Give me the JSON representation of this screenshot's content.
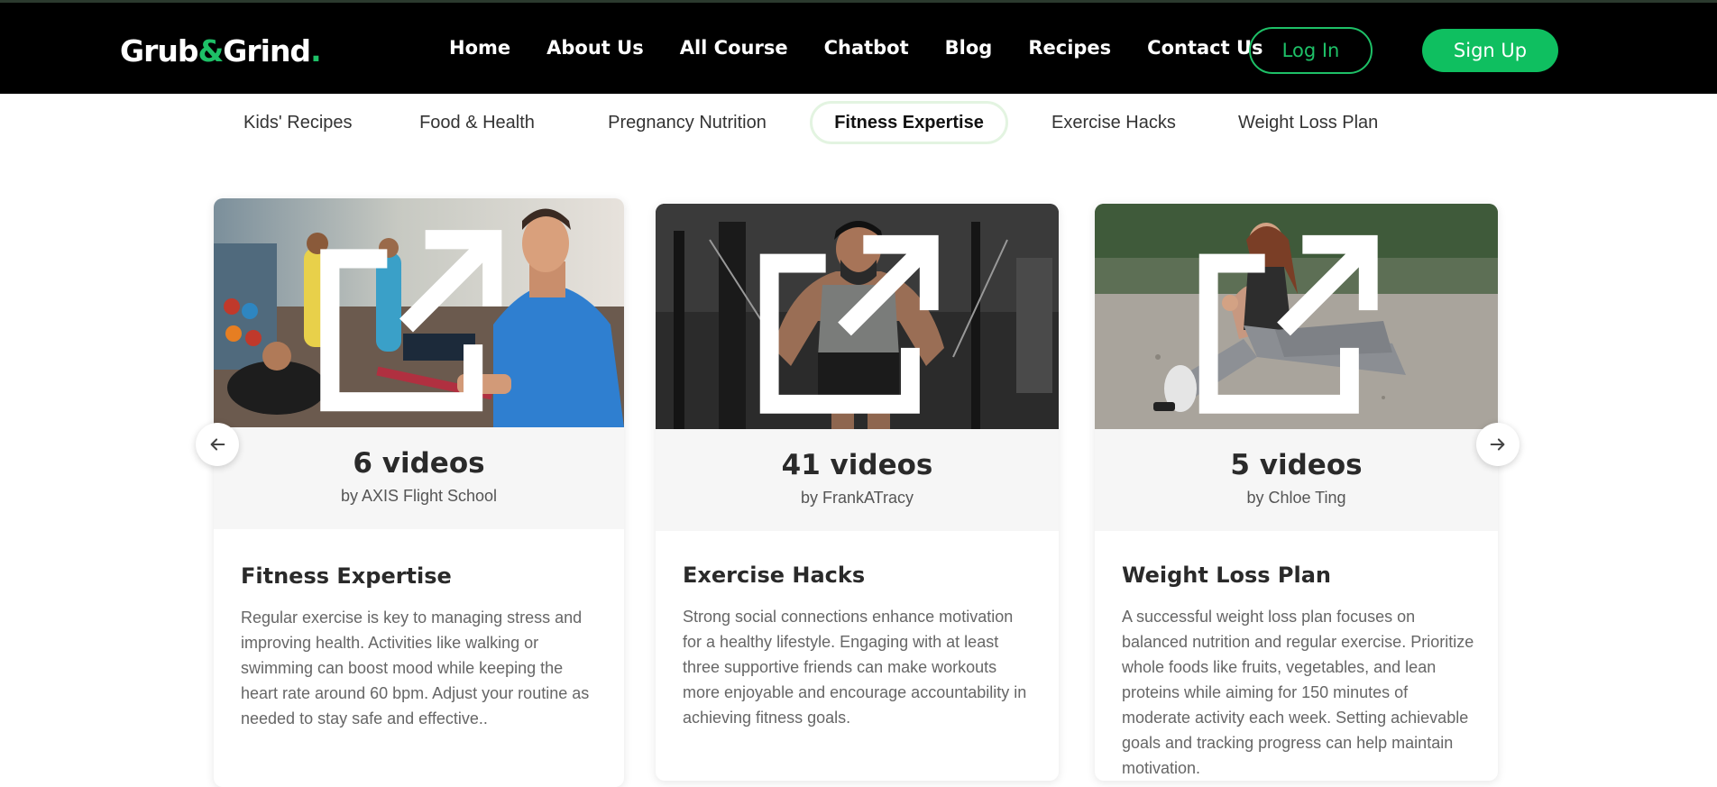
{
  "brand": {
    "part1": "Grub",
    "amp": "&",
    "part2": "Grind",
    "dot": ".",
    "accent": "#1ec067"
  },
  "nav": {
    "items": [
      "Home",
      "About Us",
      "All Course",
      "Chatbot",
      "Blog",
      "Recipes",
      "Contact Us"
    ],
    "login_label": "Log In",
    "signup_label": "Sign Up"
  },
  "tabs": {
    "items": [
      "Kids' Recipes",
      "Food & Health",
      "Pregnancy Nutrition",
      "Fitness Expertise",
      "Exercise Hacks",
      "Weight Loss Plan"
    ],
    "active": "Fitness Expertise"
  },
  "cards": [
    {
      "count": "6 videos",
      "author": "by AXIS Flight School",
      "title": "Fitness Expertise",
      "description": "Regular exercise is key to managing stress and improving health. Activities like walking or swimming can boost mood while keeping the heart rate around 60 bpm. Adjust your routine as needed to stay safe and effective..",
      "image": "fitness-trainer-photo"
    },
    {
      "count": "41 videos",
      "author": "by FrankATracy",
      "title": "Exercise Hacks",
      "description": "Strong social connections enhance motivation for a healthy lifestyle. Engaging with at least three supportive friends can make workouts more enjoyable and encourage accountability in achieving fitness goals.",
      "image": "gym-bodybuilder-photo"
    },
    {
      "count": "5 videos",
      "author": "by Chloe Ting",
      "title": "Weight Loss Plan",
      "description": "A successful weight loss plan focuses on balanced nutrition and regular exercise. Prioritize whole foods like fruits, vegetables, and lean proteins while aiming for 150 minutes of moderate activity each week. Setting achievable goals and tracking progress can help maintain motivation.",
      "image": "woman-stretching-photo"
    }
  ],
  "icons": {
    "prev": "arrow-left-icon",
    "next": "arrow-right-icon",
    "external": "external-link-icon"
  }
}
